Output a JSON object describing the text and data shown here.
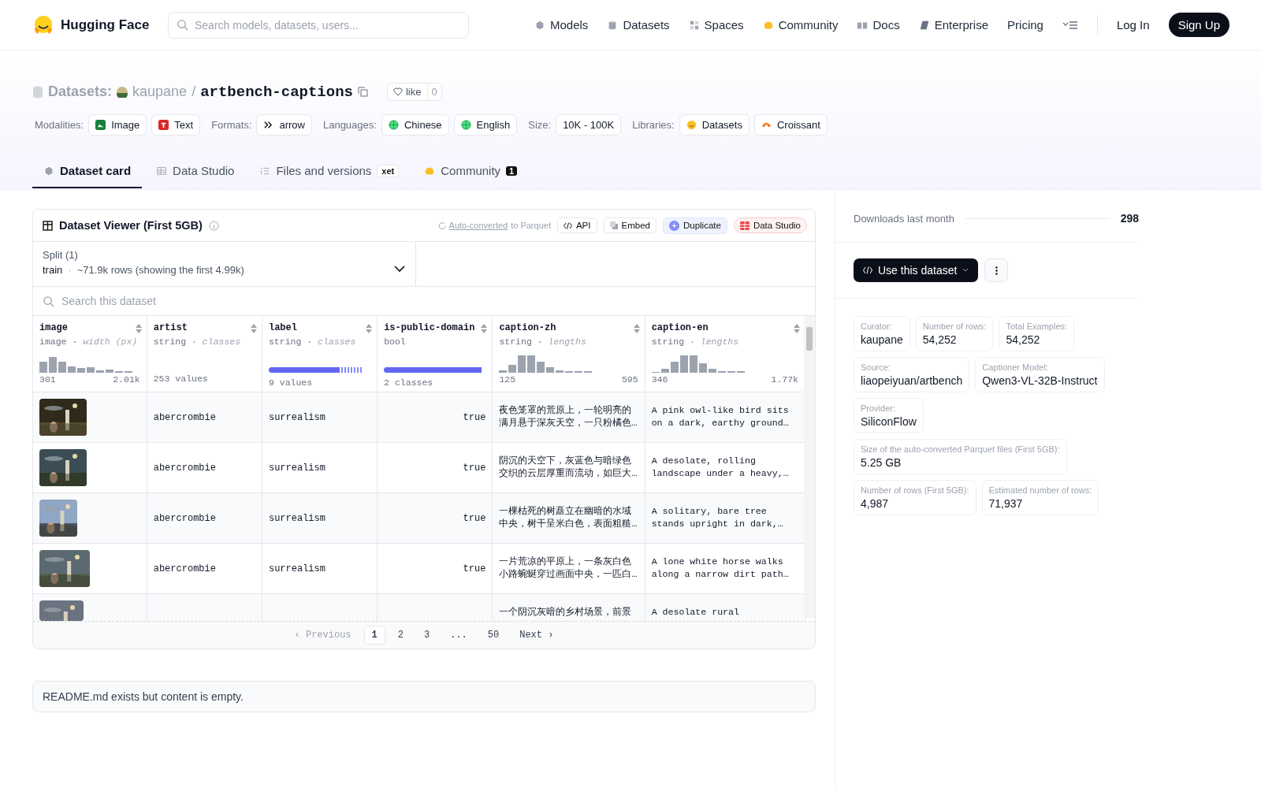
{
  "nav": {
    "logo": "Hugging Face",
    "search_placeholder": "Search models, datasets, users...",
    "links": [
      {
        "label": "Models"
      },
      {
        "label": "Datasets"
      },
      {
        "label": "Spaces"
      },
      {
        "label": "Community"
      },
      {
        "label": "Docs"
      },
      {
        "label": "Enterprise"
      },
      {
        "label": "Pricing"
      }
    ],
    "login": "Log In",
    "signup": "Sign Up"
  },
  "breadcrumb": {
    "section": "Datasets:",
    "owner": "kaupane",
    "separator": "/",
    "name": "artbench-captions",
    "like_label": "like",
    "like_count": "0"
  },
  "tag_groups": [
    {
      "heading": "Modalities:",
      "items": [
        {
          "label": "Image"
        },
        {
          "label": "Text"
        }
      ]
    },
    {
      "heading": "Formats:",
      "items": [
        {
          "label": "arrow"
        }
      ]
    },
    {
      "heading": "Languages:",
      "items": [
        {
          "label": "Chinese"
        },
        {
          "label": "English"
        }
      ]
    },
    {
      "heading": "Size:",
      "items": [
        {
          "label": "10K - 100K"
        }
      ]
    },
    {
      "heading": "Libraries:",
      "items": [
        {
          "label": "Datasets"
        },
        {
          "label": "Croissant"
        }
      ]
    }
  ],
  "tabs": [
    {
      "label": "Dataset card",
      "selected": true
    },
    {
      "label": "Data Studio",
      "selected": false
    },
    {
      "label": "Files and versions",
      "selected": false,
      "badge": "xet"
    },
    {
      "label": "Community",
      "selected": false,
      "count": "1"
    }
  ],
  "viewer": {
    "title": "Dataset Viewer (First 5GB)",
    "converted_link": "Auto-converted",
    "converted_text": "to Parquet",
    "actions": [
      {
        "label": "API"
      },
      {
        "label": "Embed"
      },
      {
        "label": "Duplicate"
      },
      {
        "label": "Data Studio"
      }
    ],
    "split_label": "Split (1)",
    "split_name": "train",
    "split_dot": "·",
    "split_rows": "~71.9k rows (showing the first 4.99k)",
    "search_placeholder": "Search this dataset",
    "columns": [
      {
        "name": "image",
        "detail": "image · *width (px)*",
        "summary": {
          "kind": "histogram",
          "low": "301",
          "high": "2.01k"
        },
        "kind": "picture"
      },
      {
        "name": "artist",
        "detail": "string · *classes*",
        "summary": {
          "kind": "values",
          "text": "253 values"
        },
        "kind": "short"
      },
      {
        "name": "label",
        "detail": "string · *classes*",
        "summary": {
          "kind": "classes",
          "text": "9 values"
        },
        "kind": "short"
      },
      {
        "name": "is-public-domain",
        "detail": "bool",
        "summary": {
          "kind": "classes",
          "text": "2 classes"
        },
        "kind": "bool"
      },
      {
        "name": "caption-zh",
        "detail": "string · *lengths*",
        "summary": {
          "kind": "histogram",
          "low": "125",
          "high": "595"
        },
        "kind": "long"
      },
      {
        "name": "caption-en",
        "detail": "string · *lengths*",
        "summary": {
          "kind": "histogram",
          "low": "346",
          "high": "1.77k"
        },
        "kind": "long"
      }
    ],
    "rows": [
      {
        "cells": [
          {
            "kind": "picture"
          },
          "abercrombie",
          "surrealism",
          "true",
          "夜色笼罩的荒原上，一轮明亮的满月悬于深灰天空，一只粉橘色…",
          "A pink owl-like bird sits\non a dark, earthy ground…"
        ]
      },
      {
        "cells": [
          {
            "kind": "picture"
          },
          "abercrombie",
          "surrealism",
          "true",
          "阴沉的天空下，灰蓝色与暗绿色交织的云层厚重而流动，如巨大…",
          "A desolate, rolling\nlandscape under a heavy,…"
        ]
      },
      {
        "cells": [
          {
            "kind": "picture"
          },
          "abercrombie",
          "surrealism",
          "true",
          "一棵枯死的树矗立在幽暗的水域中央，树干呈米白色，表面粗糙…",
          "A solitary, bare tree\nstands upright in dark,…"
        ]
      },
      {
        "cells": [
          {
            "kind": "picture"
          },
          "abercrombie",
          "surrealism",
          "true",
          "一片荒凉的平原上，一条灰白色小路蜿蜒穿过画面中央，一匹白…",
          "A lone white horse walks\nalong a narrow dirt path…"
        ]
      },
      {
        "cells": [
          {
            "kind": "picture"
          },
          "",
          "",
          "",
          "一个阴沉灰暗的乡村场景，前景",
          "A desolate rural"
        ]
      }
    ],
    "pages": [
      {
        "label": "‹ Previous",
        "kind": "prev",
        "disabled": true
      },
      {
        "label": "1",
        "selected": true
      },
      {
        "label": "2",
        "selected": false
      },
      {
        "label": "3",
        "selected": false
      },
      {
        "label": "...",
        "kind": "gap"
      },
      {
        "label": "50",
        "selected": false
      },
      {
        "label": "Next ›",
        "kind": "next",
        "disabled": false
      }
    ]
  },
  "readme_note": "README.md exists but content is empty.",
  "sidebar": {
    "downloads_label": "Downloads last month",
    "downloads": "298",
    "use_button": "Use this dataset",
    "info_rows": [
      [
        {
          "label": "Curator:",
          "value": "kaupane"
        },
        {
          "label": "Number of rows:",
          "value": "54,252"
        },
        {
          "label": "Total Examples:",
          "value": "54,252"
        }
      ],
      [
        {
          "label": "Source:",
          "value": "liaopeiyuan/artbench"
        },
        {
          "label": "Captioner Model:",
          "value": "Qwen3-VL-32B-Instruct"
        }
      ],
      [
        {
          "label": "Provider:",
          "value": "SiliconFlow"
        }
      ],
      [
        {
          "label": "Size of the auto-converted Parquet files (First 5GB):",
          "value": "5.25 GB"
        }
      ],
      [
        {
          "label": "Number of rows (First 5GB):",
          "value": "4,987"
        },
        {
          "label": "Estimated number of rows:",
          "value": "71,937"
        }
      ]
    ]
  }
}
